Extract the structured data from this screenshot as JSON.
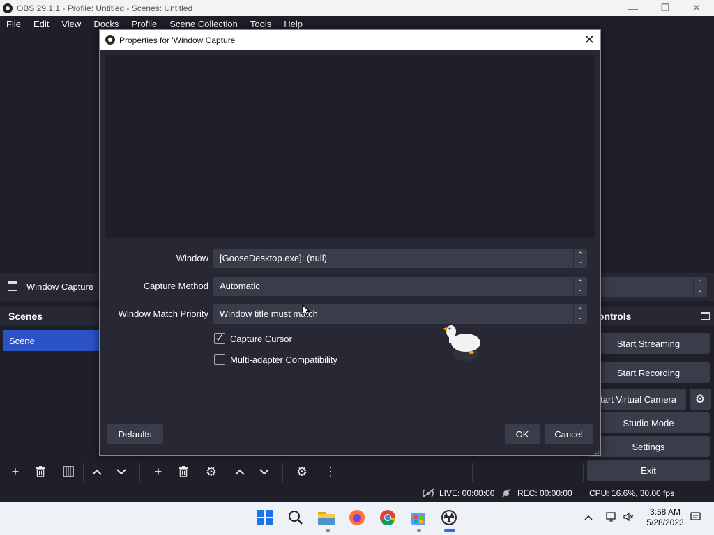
{
  "window": {
    "title": "OBS 29.1.1 - Profile: Untitled - Scenes: Untitled",
    "minimize": "—",
    "maximize": "❐",
    "close": "✕"
  },
  "menu": [
    "File",
    "Edit",
    "View",
    "Docks",
    "Profile",
    "Scene Collection",
    "Tools",
    "Help"
  ],
  "source_bar": {
    "selected_source": "Window Capture"
  },
  "scenes": {
    "header": "Scenes",
    "items": [
      "Scene"
    ]
  },
  "controls": {
    "header": "ontrols",
    "start_streaming": "Start Streaming",
    "start_recording": "Start Recording",
    "start_virtual_camera": "tart Virtual Camera",
    "studio_mode": "Studio Mode",
    "settings": "Settings",
    "exit": "Exit"
  },
  "status": {
    "live": "LIVE: 00:00:00",
    "rec": "REC: 00:00:00",
    "cpu": "CPU: 16.6%, 30.00 fps"
  },
  "dialog": {
    "title": "Properties for 'Window Capture'",
    "window_label": "Window",
    "window_value": "[GooseDesktop.exe]: (null)",
    "capture_method_label": "Capture Method",
    "capture_method_value": "Automatic",
    "match_priority_label": "Window Match Priority",
    "match_priority_value": "Window title must match",
    "capture_cursor_label": "Capture Cursor",
    "capture_cursor_checked": true,
    "multi_adapter_label": "Multi-adapter Compatibility",
    "multi_adapter_checked": false,
    "defaults": "Defaults",
    "ok": "OK",
    "cancel": "Cancel"
  },
  "taskbar": {
    "time": "3:58 AM",
    "date": "5/28/2023",
    "apps": [
      "start-icon",
      "search-icon",
      "file-explorer-icon",
      "firefox-icon",
      "chrome-icon",
      "store-icon",
      "obs-icon"
    ]
  },
  "colors": {
    "background": "#1e1f29",
    "panel": "#272834",
    "button": "#3b3c4a",
    "selected": "#2b53c6"
  }
}
